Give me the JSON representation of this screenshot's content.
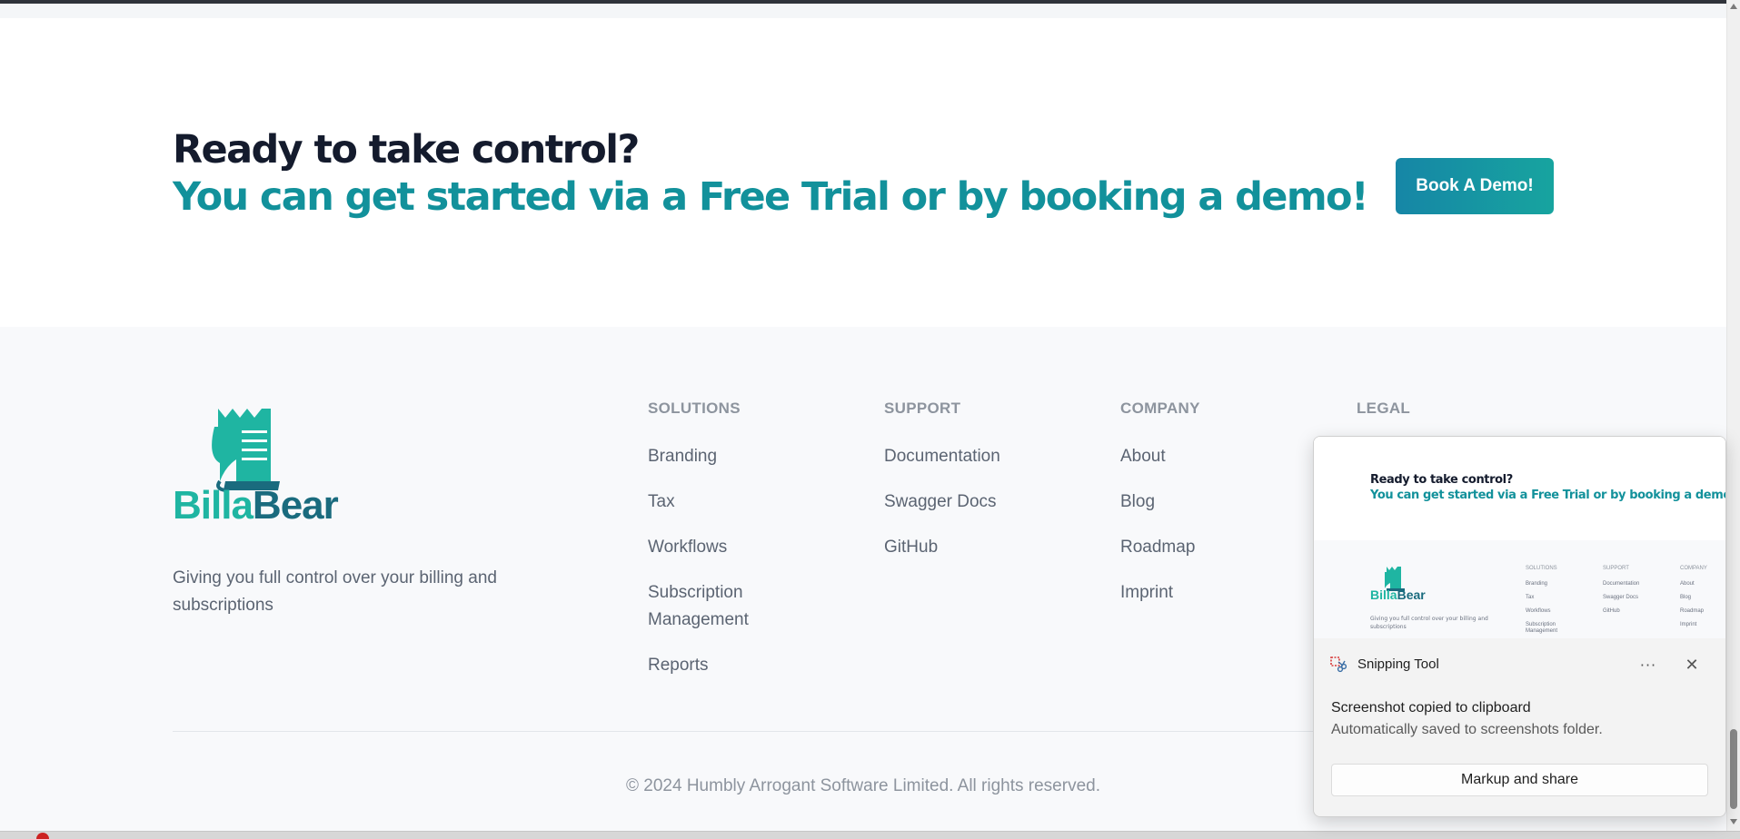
{
  "cta": {
    "title_line1": "Ready to take control?",
    "title_line2": "You can get started via a Free Trial or by booking a demo!",
    "button_label": "Book A Demo!"
  },
  "footer": {
    "brand_part1": "Billa",
    "brand_part2": "Bear",
    "tagline": "Giving you full control over your billing and subscriptions",
    "columns": [
      {
        "heading": "SOLUTIONS",
        "links": [
          "Branding",
          "Tax",
          "Workflows",
          "Subscription Management",
          "Reports"
        ]
      },
      {
        "heading": "SUPPORT",
        "links": [
          "Documentation",
          "Swagger Docs",
          "GitHub"
        ]
      },
      {
        "heading": "COMPANY",
        "links": [
          "About",
          "Blog",
          "Roadmap",
          "Imprint"
        ]
      },
      {
        "heading": "LEGAL",
        "links": []
      }
    ],
    "copyright": "© 2024 Humbly Arrogant Software Limited. All rights reserved."
  },
  "toast": {
    "app_name": "Snipping Tool",
    "more_icon": "more-icon",
    "close_icon": "close-icon",
    "message_title": "Screenshot copied to clipboard",
    "message_subtitle": "Automatically saved to screenshots folder.",
    "action_label": "Markup and share",
    "thumbnail": {
      "title_line1": "Ready to take control?",
      "title_line2": "You can get started via a Free Trial or by booking a demo!",
      "brand_part1": "Billa",
      "brand_part2": "Bear",
      "tagline": "Giving you full control over your billing and subscriptions",
      "columns": [
        {
          "heading": "SOLUTIONS",
          "links": [
            "Branding",
            "Tax",
            "Workflows",
            "Subscription",
            "Management"
          ]
        },
        {
          "heading": "SUPPORT",
          "links": [
            "Documentation",
            "Swagger Docs",
            "GitHub"
          ]
        },
        {
          "heading": "COMPANY",
          "links": [
            "About",
            "Blog",
            "Roadmap",
            "Imprint"
          ]
        }
      ]
    }
  },
  "colors": {
    "accent_teal": "#12919b",
    "brand_teal_light": "#1fb5a2",
    "brand_teal_dark": "#1a6b7e",
    "heading_dark": "#141b2d",
    "footer_bg": "#f8f9fb"
  }
}
